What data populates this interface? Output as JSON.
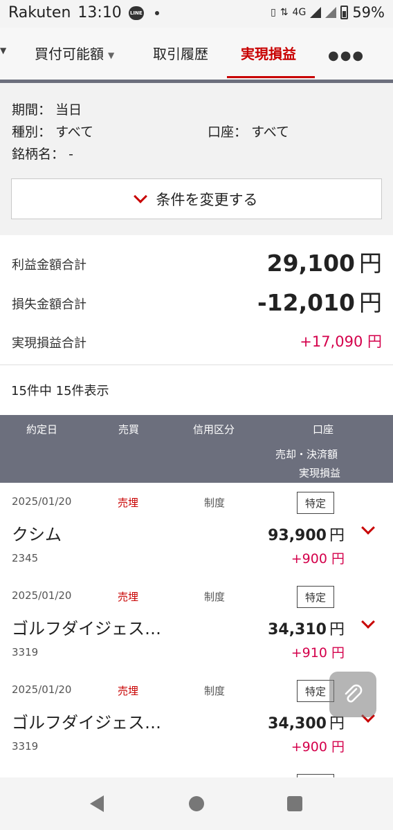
{
  "status_bar": {
    "carrier": "Rakuten",
    "time": "13:10",
    "network": "4G",
    "battery": "59%"
  },
  "tabs": {
    "items": [
      {
        "label": "買付可能額"
      },
      {
        "label": "取引履歴"
      },
      {
        "label": "実現損益"
      }
    ],
    "active": "実現損益"
  },
  "filters": {
    "period_label": "期間：",
    "period_value": "当日",
    "type_label": "種別：",
    "type_value": "すべて",
    "account_label": "口座：",
    "account_value": "すべて",
    "name_label": "銘柄名：",
    "name_value": "-",
    "change_button": "条件を変更する"
  },
  "summary": {
    "profit_label": "利益金額合計",
    "profit_value": "29,100",
    "loss_label": "損失金額合計",
    "loss_value": "-12,010",
    "realized_label": "実現損益合計",
    "realized_value": "+17,090 円",
    "yen": "円"
  },
  "count_text": "15件中 15件表示",
  "table_header": {
    "date": "約定日",
    "side": "売買",
    "credit": "信用区分",
    "account": "口座",
    "amount": "売却・決済額",
    "pl": "実現損益"
  },
  "rows": [
    {
      "date": "2025/01/20",
      "side": "売埋",
      "kind": "制度",
      "account": "特定",
      "name": "クシム",
      "code": "2345",
      "amount": "93,900",
      "pl": "+900 円"
    },
    {
      "date": "2025/01/20",
      "side": "売埋",
      "kind": "制度",
      "account": "特定",
      "name": "ゴルフダイジェス…",
      "code": "3319",
      "amount": "34,310",
      "pl": "+910 円"
    },
    {
      "date": "2025/01/20",
      "side": "売埋",
      "kind": "制度",
      "account": "特定",
      "name": "ゴルフダイジェス…",
      "code": "3319",
      "amount": "34,300",
      "pl": "+900 円"
    }
  ],
  "colors": {
    "accent_red": "#c80000",
    "profit_pink": "#d4004b",
    "header_gray": "#6c6f7d"
  }
}
